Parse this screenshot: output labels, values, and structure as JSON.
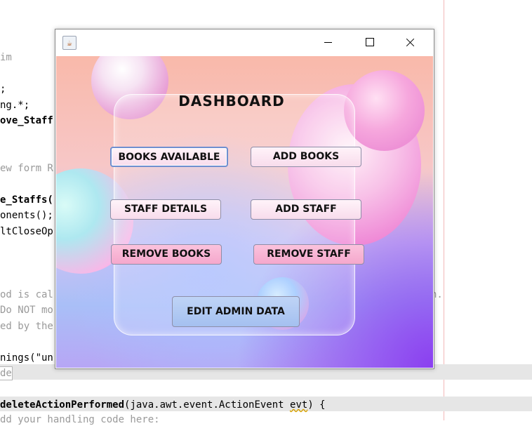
{
  "editor": {
    "lines": [
      {
        "text": "im",
        "style": "gray"
      },
      {
        "text": ";",
        "style": "normal"
      },
      {
        "text": "ng.*;",
        "style": "normal"
      },
      {
        "text": "ove_Staff",
        "style": "bold"
      },
      {
        "text": "ew form R",
        "style": "gray"
      },
      {
        "text": "e_Staffs(",
        "style": "bold"
      },
      {
        "text": "onents();",
        "style": "normal"
      },
      {
        "text": "ltCloseOp",
        "style": "normal"
      },
      {
        "text": "od is cal",
        "style": "gray"
      },
      {
        "text": "Do NOT mo",
        "style": "gray"
      },
      {
        "text": "ed by the",
        "style": "gray"
      },
      {
        "text": "n.",
        "style": "gray"
      },
      {
        "text": "nings(\"un",
        "style": "normal"
      },
      {
        "text": "de",
        "style": "gray"
      },
      {
        "text_prefix": "deleteActionPerformed",
        "text_mid": "(java.awt.event.ActionEvent ",
        "text_squiggle": "evt",
        "text_end": ") {"
      },
      {
        "text": "dd your handling code here:",
        "style": "gray"
      }
    ]
  },
  "window": {
    "icon": "java-coffee-icon",
    "controls": [
      "minimize-icon",
      "maximize-icon",
      "close-icon"
    ]
  },
  "dashboard": {
    "title": "DASHBOARD",
    "buttons": {
      "books_available": "BOOKS AVAILABLE",
      "add_books": "ADD BOOKS",
      "staff_details": "STAFF DETAILS",
      "add_staff": "ADD STAFF",
      "remove_books": "REMOVE BOOKS",
      "remove_staff": "REMOVE STAFF",
      "edit_admin_data": "EDIT ADMIN DATA"
    }
  },
  "colors": {
    "pink_button": "#f5a8cc",
    "light_button": "#f8dcec",
    "blue_button": "#a4c0f0",
    "focus_border": "#6f8fd0"
  }
}
